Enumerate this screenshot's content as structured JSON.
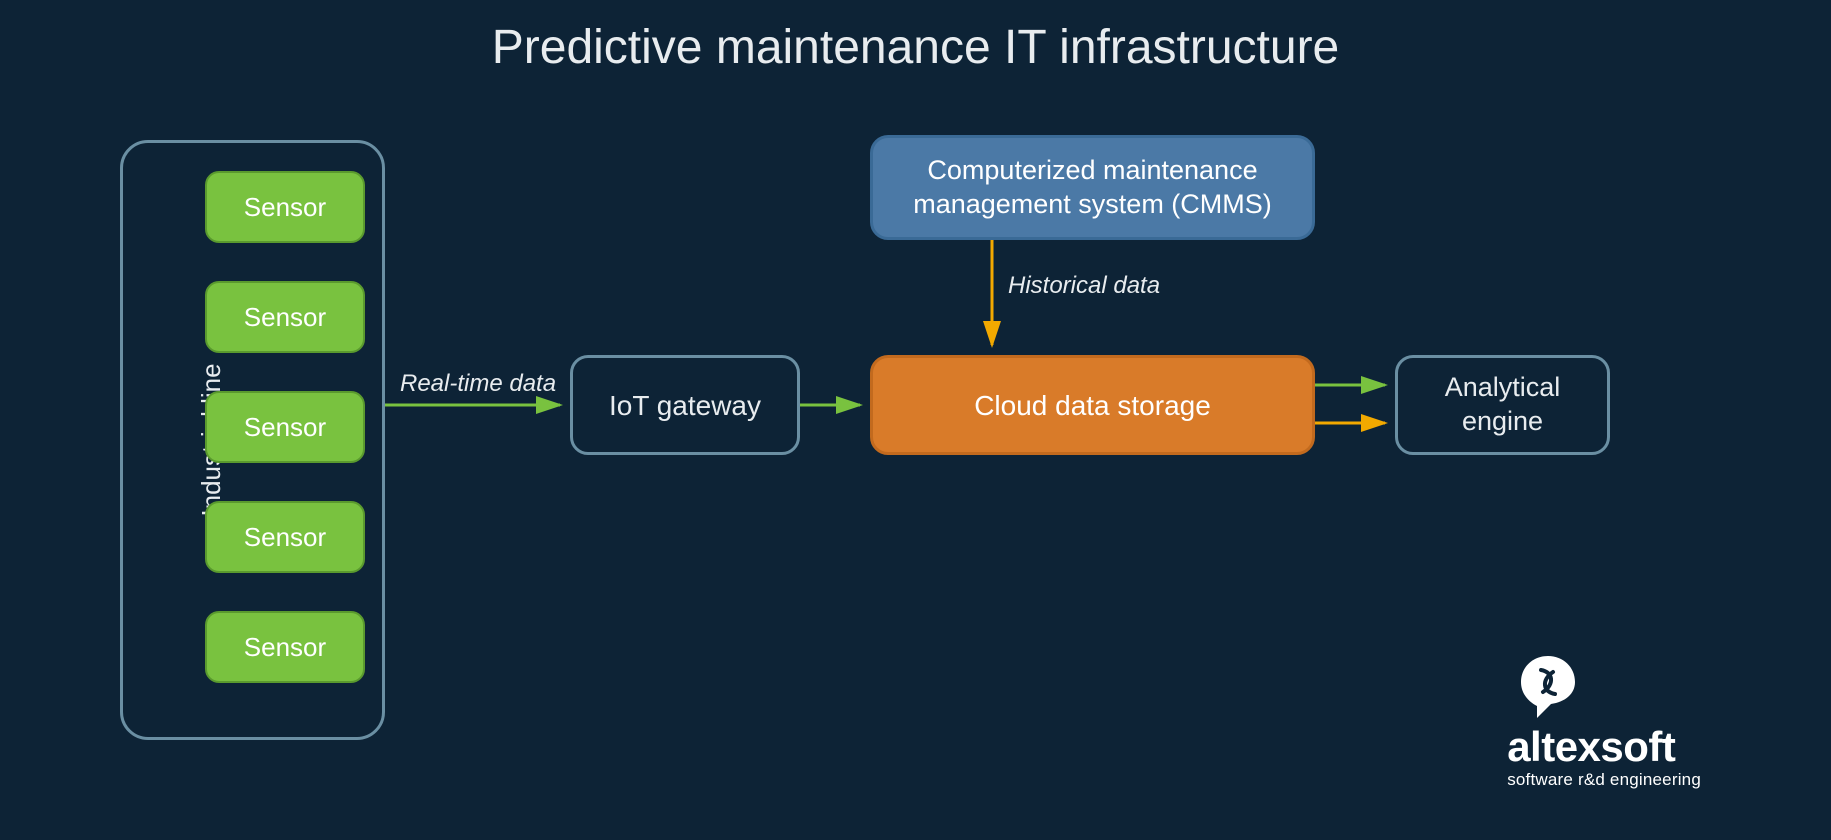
{
  "title": "Predictive maintenance IT infrastructure",
  "industrial": {
    "label": "Industrial line",
    "sensors": [
      "Sensor",
      "Sensor",
      "Sensor",
      "Sensor",
      "Sensor"
    ]
  },
  "nodes": {
    "iot_gateway": "IoT gateway",
    "cmms": "Computerized maintenance management system (CMMS)",
    "cloud_storage": "Cloud data storage",
    "analytical_engine": "Analytical engine"
  },
  "flow_labels": {
    "real_time": "Real-time data",
    "historical": "Historical data"
  },
  "colors": {
    "background": "#0d2336",
    "sensor": "#79c23f",
    "cmms": "#4b79a6",
    "cloud": "#d97b29",
    "arrow_green": "#79c23f",
    "arrow_yellow": "#f2a900",
    "outline": "#6a8fa3"
  },
  "logo": {
    "name": "altexsoft",
    "tagline": "software r&d engineering"
  }
}
